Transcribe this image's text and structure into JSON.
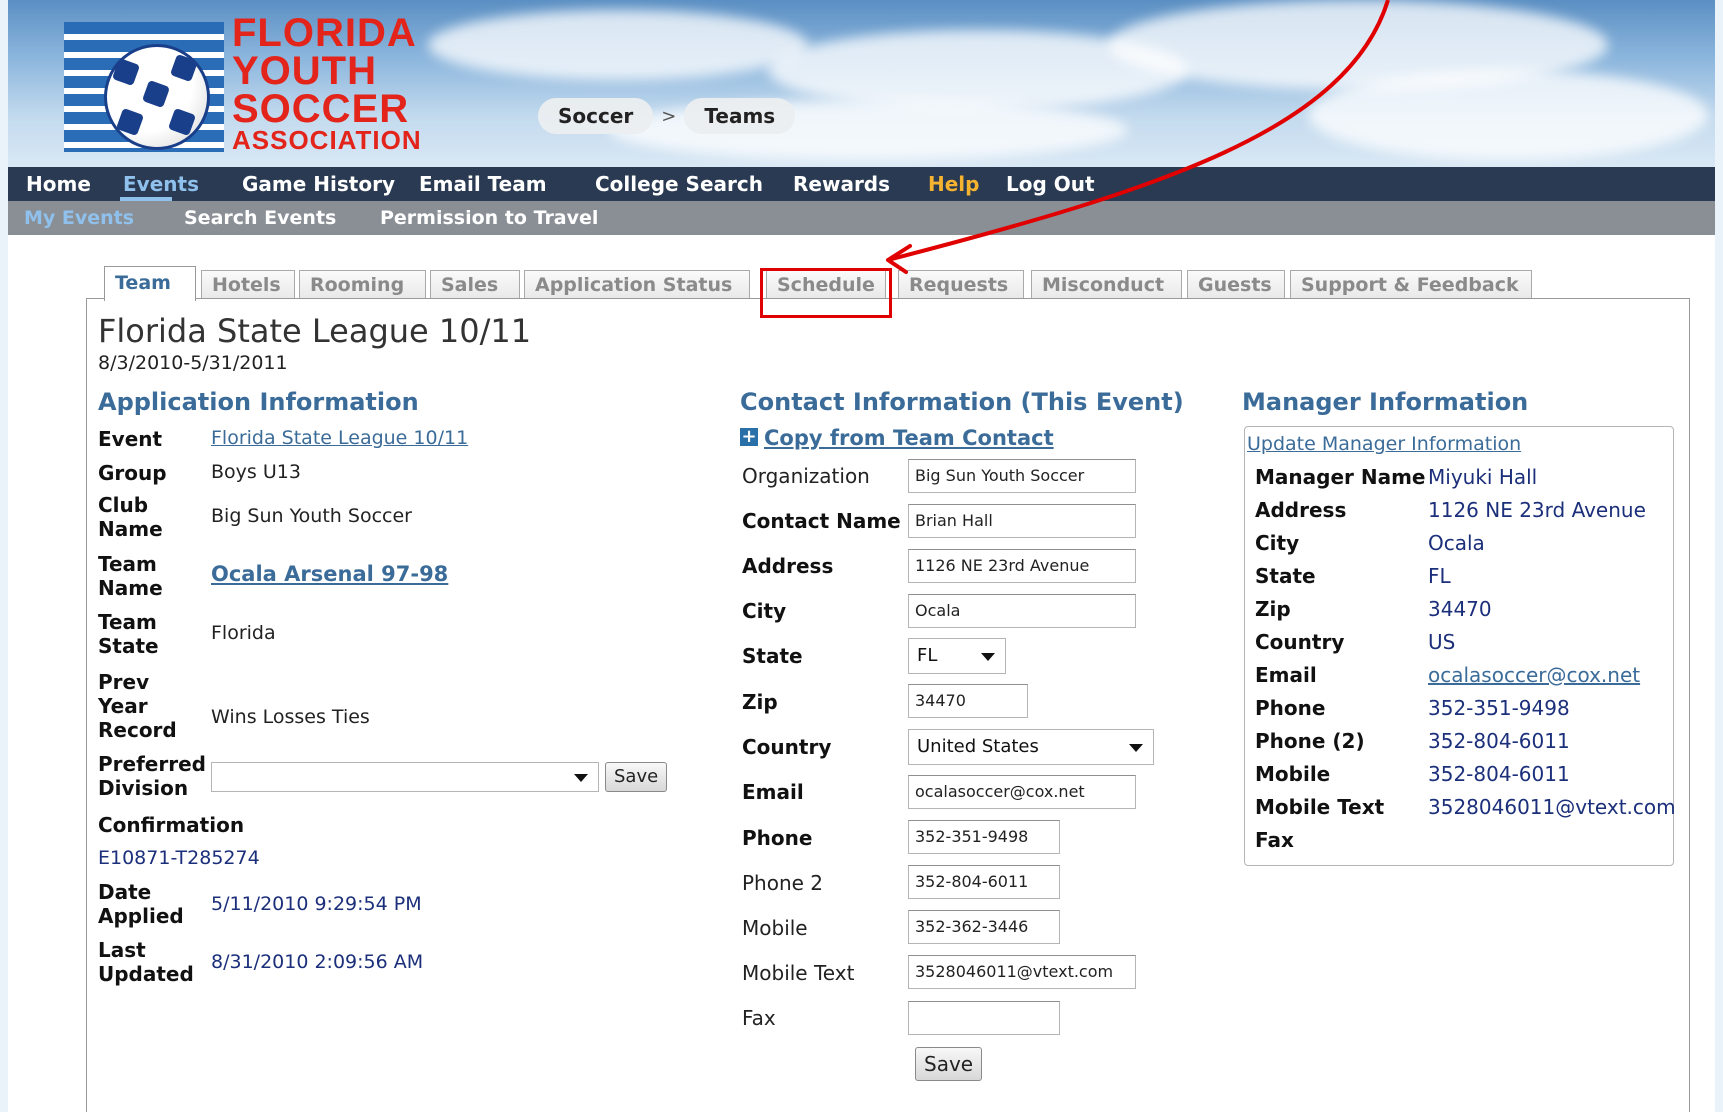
{
  "header": {
    "logo_lines": [
      "FLORIDA",
      "YOUTH",
      "SOCCER",
      "ASSOCIATION"
    ],
    "breadcrumb": [
      "Soccer",
      "Teams"
    ],
    "breadcrumb_sep": ">"
  },
  "main_nav": [
    "Home",
    "Events",
    "Game History",
    "Email Team",
    "College Search",
    "Rewards",
    "Help",
    "Log Out"
  ],
  "sub_nav": [
    "My Events",
    "Search Events",
    "Permission to Travel"
  ],
  "tabs": [
    "Team",
    "Hotels",
    "Rooming",
    "Sales",
    "Application Status",
    "Schedule",
    "Requests",
    "Misconduct",
    "Guests",
    "Support & Feedback"
  ],
  "event": {
    "title": "Florida State League 10/11",
    "dates": "8/3/2010-5/31/2011"
  },
  "application": {
    "heading": "Application Information",
    "event_label": "Event",
    "event_value": "Florida State League 10/11",
    "group_label": "Group",
    "group_value": "Boys U13",
    "club_label_1": "Club",
    "club_label_2": "Name",
    "club_value": "Big Sun Youth Soccer",
    "team_label_1": "Team",
    "team_label_2": "Name",
    "team_value": "Ocala Arsenal 97-98",
    "state_label_1": "Team",
    "state_label_2": "State",
    "state_value": "Florida",
    "record_label_1": "Prev",
    "record_label_2": "Year",
    "record_label_3": "Record",
    "record_value": "Wins Losses Ties",
    "division_label_1": "Preferred",
    "division_label_2": "Division",
    "division_value": "",
    "save_label": "Save",
    "confirmation_label": "Confirmation",
    "confirmation_value": "E10871-T285274",
    "applied_label_1": "Date",
    "applied_label_2": "Applied",
    "applied_value": "5/11/2010 9:29:54 PM",
    "updated_label_1": "Last",
    "updated_label_2": "Updated",
    "updated_value": "8/31/2010 2:09:56 AM"
  },
  "contact": {
    "heading": "Contact Information (This Event)",
    "copy_link": "Copy from Team Contact",
    "labels": {
      "organization": "Organization",
      "contact_name": "Contact Name",
      "address": "Address",
      "city": "City",
      "state": "State",
      "zip": "Zip",
      "country": "Country",
      "email": "Email",
      "phone": "Phone",
      "phone2": "Phone 2",
      "mobile": "Mobile",
      "mobile_text": "Mobile Text",
      "fax": "Fax"
    },
    "values": {
      "organization": "Big Sun Youth Soccer",
      "contact_name": "Brian Hall",
      "address": "1126 NE 23rd Avenue",
      "city": "Ocala",
      "state": "FL",
      "zip": "34470",
      "country": "United States",
      "email": "ocalasoccer@cox.net",
      "phone": "352-351-9498",
      "phone2": "352-804-6011",
      "mobile": "352-362-3446",
      "mobile_text": "3528046011@vtext.com",
      "fax": ""
    },
    "save_label": "Save"
  },
  "manager": {
    "heading": "Manager Information",
    "update_link": "Update Manager Information",
    "labels": {
      "name": "Manager Name",
      "address": "Address",
      "city": "City",
      "state": "State",
      "zip": "Zip",
      "country": "Country",
      "email": "Email",
      "phone": "Phone",
      "phone2": "Phone (2)",
      "mobile": "Mobile",
      "mobile_text": "Mobile Text",
      "fax": "Fax"
    },
    "values": {
      "name": "Miyuki Hall",
      "address": "1126 NE 23rd Avenue",
      "city": "Ocala",
      "state": "FL",
      "zip": "34470",
      "country": "US",
      "email": "ocalasoccer@cox.net",
      "phone": "352-351-9498",
      "phone2": "352-804-6011",
      "mobile": "352-804-6011",
      "mobile_text": "3528046011@vtext.com",
      "fax": ""
    }
  },
  "colors": {
    "accent": "#3b6c99",
    "nav_bg": "#2a3a52",
    "subnav_bg": "#8a8f96",
    "help": "#f5b330",
    "annotation": "#e00000"
  }
}
